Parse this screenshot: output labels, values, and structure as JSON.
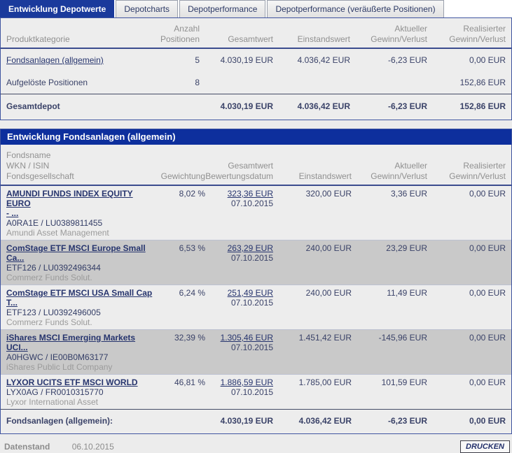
{
  "tabs": [
    {
      "label": "Entwicklung Depotwerte"
    },
    {
      "label": "Depotcharts"
    },
    {
      "label": "Depotperformance"
    },
    {
      "label": "Depotperformance (veräußerte Positionen)"
    }
  ],
  "summary": {
    "headers": {
      "category": "Produktkategorie",
      "positions": [
        "Anzahl",
        "Positionen"
      ],
      "total": "Gesamtwert",
      "cost": "Einstandswert",
      "gain": [
        "Aktueller",
        "Gewinn/Verlust"
      ],
      "realized": [
        "Realisierter",
        "Gewinn/Verlust"
      ]
    },
    "rows": [
      {
        "category": "Fondsanlagen (allgemein)",
        "positions": "5",
        "total": "4.030,19 EUR",
        "cost": "4.036,42 EUR",
        "gain": "-6,23 EUR",
        "realized": "0,00 EUR"
      },
      {
        "category": "Aufgelöste Positionen",
        "positions": "8",
        "total": "",
        "cost": "",
        "gain": "",
        "realized": "152,86 EUR"
      }
    ],
    "total_row": {
      "label": "Gesamtdepot",
      "total": "4.030,19 EUR",
      "cost": "4.036,42 EUR",
      "gain": "-6,23 EUR",
      "realized": "152,86 EUR"
    }
  },
  "funds": {
    "title": "Entwicklung Fondsanlagen (allgemein)",
    "headers": {
      "name_lines": [
        "Fondsname",
        "WKN / ISIN",
        "Fondsgesellschaft"
      ],
      "weight": "Gewichtung",
      "value": [
        "Gesamtwert",
        "Bewertungsdatum"
      ],
      "cost": "Einstandswert",
      "gain": [
        "Aktueller",
        "Gewinn/Verlust"
      ],
      "realized": [
        "Realisierter",
        "Gewinn/Verlust"
      ]
    },
    "rows": [
      {
        "name_lines": [
          "AMUNDI FUNDS INDEX EQUITY EURO",
          "- ..."
        ],
        "wkn_isin": "A0RA1E / LU0389811455",
        "company": "Amundi Asset Management",
        "weight": "8,02 %",
        "value": "323,36 EUR",
        "value_date": "07.10.2015",
        "cost": "320,00 EUR",
        "gain": "3,36 EUR",
        "realized": "0,00 EUR"
      },
      {
        "name_lines": [
          "ComStage ETF MSCI Europe Small",
          "Ca..."
        ],
        "wkn_isin": "ETF126 / LU0392496344",
        "company": "Commerz Funds Solut.",
        "weight": "6,53 %",
        "value": "263,29 EUR",
        "value_date": "07.10.2015",
        "cost": "240,00 EUR",
        "gain": "23,29 EUR",
        "realized": "0,00 EUR"
      },
      {
        "name_lines": [
          "ComStage ETF MSCI USA Small Cap",
          "T..."
        ],
        "wkn_isin": "ETF123 / LU0392496005",
        "company": "Commerz Funds Solut.",
        "weight": "6,24 %",
        "value": "251,49 EUR",
        "value_date": "07.10.2015",
        "cost": "240,00 EUR",
        "gain": "11,49 EUR",
        "realized": "0,00 EUR"
      },
      {
        "name_lines": [
          "iShares MSCI Emerging Markets",
          "UCI..."
        ],
        "wkn_isin": "A0HGWC / IE00B0M63177",
        "company": "iShares Public Ldt Company",
        "weight": "32,39 %",
        "value": "1.305,46 EUR",
        "value_date": "07.10.2015",
        "cost": "1.451,42 EUR",
        "gain": "-145,96 EUR",
        "realized": "0,00 EUR"
      },
      {
        "name_lines": [
          "LYXOR UCITS ETF MSCI WORLD"
        ],
        "wkn_isin": "LYX0AG / FR0010315770",
        "company": "Lyxor International Asset",
        "weight": "46,81 %",
        "value": "1.886,59 EUR",
        "value_date": "07.10.2015",
        "cost": "1.785,00 EUR",
        "gain": "101,59 EUR",
        "realized": "0,00 EUR"
      }
    ],
    "footer": {
      "label": "Fondsanlagen (allgemein):",
      "total": "4.030,19 EUR",
      "cost": "4.036,42 EUR",
      "gain": "-6,23 EUR",
      "realized": "0,00 EUR"
    }
  },
  "statusbar": {
    "datenstand_label": "Datenstand",
    "datenstand_value": "06.10.2015",
    "print_label": "DRUCKEN"
  },
  "colors": {
    "accent_navy": "#0d2f9d",
    "active_tab_navy": "#1a3a9c",
    "panel_border": "#4055a0",
    "stripe_gray": "#c9c9c9",
    "text_navy": "#3a4268",
    "link_navy": "#27356e",
    "muted_gray": "#909090"
  }
}
